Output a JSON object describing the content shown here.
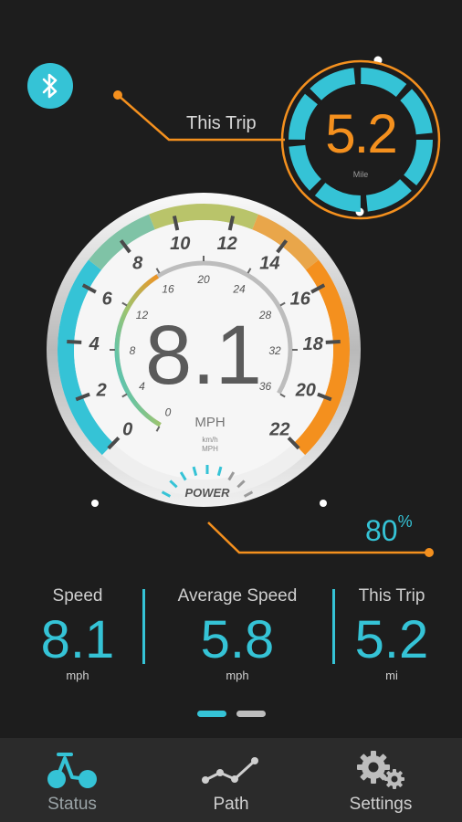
{
  "bluetooth": {
    "icon": "bluetooth-icon"
  },
  "trip_badge": {
    "label": "This Trip",
    "value": "5.2",
    "unit": "Mile"
  },
  "gauge": {
    "speed_value": "8.1",
    "speed_unit": "MPH",
    "small_units_top": "km/h",
    "small_units_bottom": "MPH",
    "power_label": "POWER",
    "mph_ticks": [
      "0",
      "2",
      "4",
      "6",
      "8",
      "10",
      "12",
      "14",
      "16",
      "18",
      "20",
      "22"
    ],
    "kmh_ticks": [
      "0",
      "4",
      "8",
      "12",
      "16",
      "20",
      "24",
      "28",
      "32",
      "36"
    ],
    "speed_reading_mph": 8.1
  },
  "battery": {
    "value": "80",
    "unit": "%"
  },
  "stats": [
    {
      "label": "Speed",
      "value": "8.1",
      "unit": "mph"
    },
    {
      "label": "Average Speed",
      "value": "5.8",
      "unit": "mph"
    },
    {
      "label": "This Trip",
      "value": "5.2",
      "unit": "mi"
    }
  ],
  "pager": {
    "active_index": 0,
    "count": 2
  },
  "tabs": [
    {
      "label": "Status",
      "icon": "bicycle-icon"
    },
    {
      "label": "Path",
      "icon": "path-graph-icon"
    },
    {
      "label": "Settings",
      "icon": "gears-icon"
    }
  ],
  "colors": {
    "accent_cyan": "#35c3d6",
    "accent_orange": "#f4901e",
    "background": "#1d1d1d",
    "tabbar": "#2b2b2b"
  }
}
